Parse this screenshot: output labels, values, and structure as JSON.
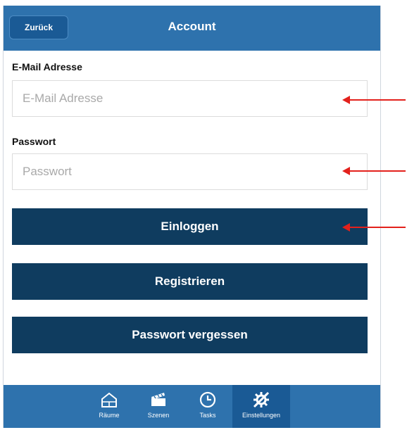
{
  "header": {
    "back_label": "Zurück",
    "title": "Account"
  },
  "form": {
    "email_label": "E-Mail Adresse",
    "email_placeholder": "E-Mail Adresse",
    "password_label": "Passwort",
    "password_placeholder": "Passwort"
  },
  "buttons": {
    "login": "Einloggen",
    "register": "Registrieren",
    "forgot": "Passwort vergessen"
  },
  "tabbar": {
    "items": [
      {
        "label": "Räume",
        "icon": "rooms-icon"
      },
      {
        "label": "Szenen",
        "icon": "scenes-icon"
      },
      {
        "label": "Tasks",
        "icon": "clock-icon"
      },
      {
        "label": "Einstellungen",
        "icon": "settings-icon"
      }
    ],
    "active_index": 3
  },
  "colors": {
    "header_bg": "#2e72ad",
    "button_bg": "#0f3c5f",
    "annotation_arrow": "#e3211c"
  }
}
